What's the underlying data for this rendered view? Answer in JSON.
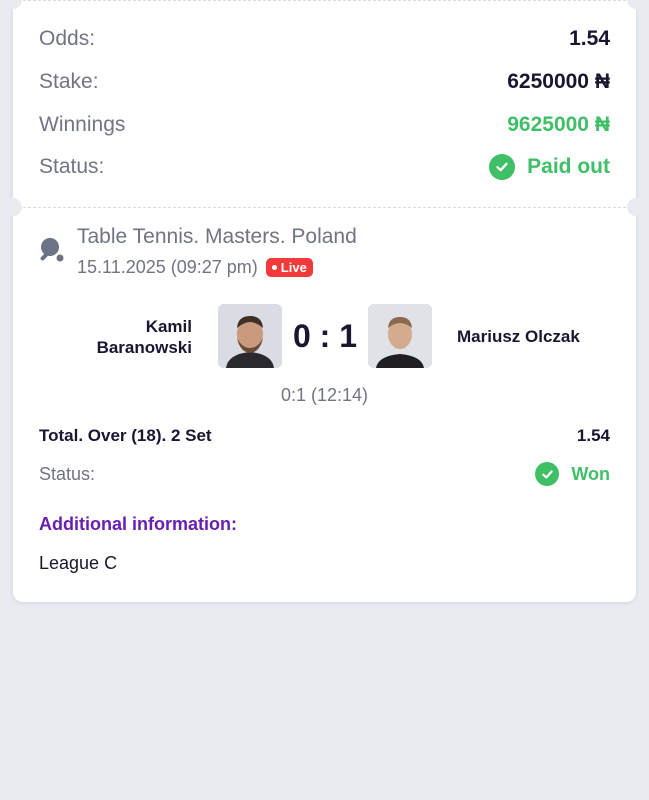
{
  "summary": {
    "odds_label": "Odds:",
    "odds_value": "1.54",
    "stake_label": "Stake:",
    "stake_value": "6250000 ₦",
    "winnings_label": "Winnings",
    "winnings_value": "9625000 ₦",
    "status_label": "Status:",
    "status_value": "Paid out"
  },
  "event": {
    "sport_icon": "table-tennis-icon",
    "league": "Table Tennis. Masters. Poland",
    "datetime": "15.11.2025 (09:27 pm)",
    "live_label": "Live",
    "player1": "Kamil Baranowski",
    "player2": "Mariusz Olczak",
    "score": "0 : 1",
    "sub_score": "0:1 (12:14)"
  },
  "bet": {
    "market": "Total. Over (18). 2 Set",
    "odds": "1.54",
    "status_label": "Status:",
    "status_value": "Won"
  },
  "additional": {
    "title": "Additional information:",
    "value": "League C"
  },
  "colors": {
    "background": "#e8ecf1",
    "green": "#3fbf66",
    "live_red": "#f23a3a",
    "accent_purple": "#6a1fb0",
    "text_dark": "#1b1530",
    "text_muted": "#707586"
  }
}
